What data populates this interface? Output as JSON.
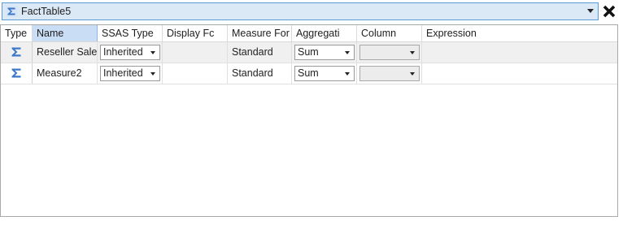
{
  "table_selector": {
    "value": "FactTable5"
  },
  "columns": [
    "Type",
    "Name",
    "SSAS Type",
    "Display Fc",
    "Measure For",
    "Aggregati",
    "Column",
    "Expression"
  ],
  "rows": [
    {
      "type_icon": "sigma-icon",
      "name": "Reseller Sales",
      "ssas_type": "Inherited",
      "display_folder": "",
      "measure_format": "Standard",
      "aggregation": "Sum",
      "column": "",
      "expression": ""
    },
    {
      "type_icon": "sigma-icon",
      "name": "Measure2",
      "ssas_type": "Inherited",
      "display_folder": "",
      "measure_format": "Standard",
      "aggregation": "Sum",
      "column": "",
      "expression": ""
    }
  ],
  "colors": {
    "header_selected": "#c9def5",
    "selector_bg": "#dbe8f6",
    "selector_border": "#5b9bd5",
    "sigma_blue": "#3a78c9"
  }
}
